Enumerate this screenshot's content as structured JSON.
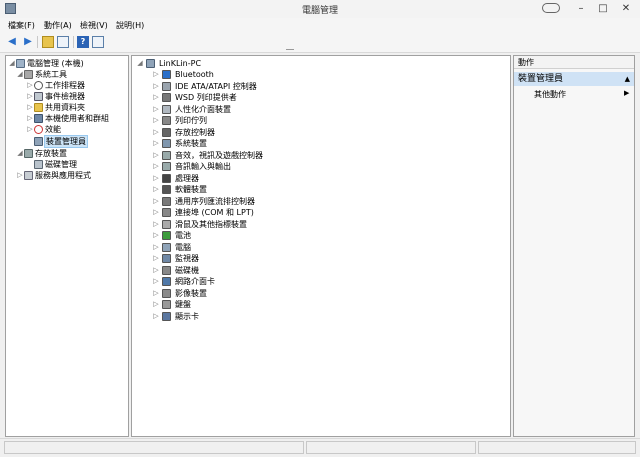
{
  "window": {
    "title": "電腦管理",
    "restore_label": "",
    "minimize_label": "–",
    "maximize_label": "□",
    "close_label": "✕"
  },
  "menu": [
    "檔案(F)",
    "動作(A)",
    "檢視(V)",
    "說明(H)"
  ],
  "toolbar": {
    "icons": [
      "back-arrow-icon",
      "forward-arrow-icon",
      "folder-up-icon",
      "show-hide-tree-icon",
      "help-icon",
      "console-icon"
    ]
  },
  "left_tree": [
    {
      "label": "電腦管理 (本機)",
      "icon": "computer-management-icon",
      "expander": "◢"
    },
    {
      "label": "系統工具",
      "icon": "system-tools-icon",
      "expander": "◢"
    },
    {
      "label": "工作排程器",
      "icon": "clock-icon",
      "expander": "▷"
    },
    {
      "label": "事件檢視器",
      "icon": "event-viewer-icon",
      "expander": "▷"
    },
    {
      "label": "共用資料夾",
      "icon": "shared-folder-icon",
      "expander": "▷"
    },
    {
      "label": "本機使用者和群組",
      "icon": "users-icon",
      "expander": "▷"
    },
    {
      "label": "效能",
      "icon": "performance-icon",
      "expander": "▷"
    },
    {
      "label": "裝置管理員",
      "icon": "device-manager-icon",
      "expander": ""
    },
    {
      "label": "存放裝置",
      "icon": "storage-icon",
      "expander": "◢"
    },
    {
      "label": "磁碟管理",
      "icon": "disk-management-icon",
      "expander": ""
    },
    {
      "label": "服務與應用程式",
      "icon": "services-icon",
      "expander": "▷"
    }
  ],
  "device_tree": {
    "root": {
      "label": "LinKLin-PC",
      "icon": "computer-icon",
      "expander": "◢"
    },
    "items": [
      {
        "label": "Bluetooth",
        "icon": "bluetooth-icon"
      },
      {
        "label": "IDE ATA/ATAPI 控制器",
        "icon": "ide-controller-icon"
      },
      {
        "label": "WSD 列印提供者",
        "icon": "printer-icon"
      },
      {
        "label": "人性化介面裝置",
        "icon": "hid-icon"
      },
      {
        "label": "列印佇列",
        "icon": "print-queue-icon"
      },
      {
        "label": "存放控制器",
        "icon": "storage-controller-icon"
      },
      {
        "label": "系統裝置",
        "icon": "system-device-icon"
      },
      {
        "label": "音效，視訊及遊戲控制器",
        "icon": "sound-icon"
      },
      {
        "label": "音訊輸入與輸出",
        "icon": "audio-io-icon"
      },
      {
        "label": "處理器",
        "icon": "processor-icon"
      },
      {
        "label": "軟體裝置",
        "icon": "software-device-icon"
      },
      {
        "label": "通用序列匯流排控制器",
        "icon": "usb-icon"
      },
      {
        "label": "連接埠 (COM 和 LPT)",
        "icon": "port-icon"
      },
      {
        "label": "滑鼠及其他指標裝置",
        "icon": "mouse-icon"
      },
      {
        "label": "電池",
        "icon": "battery-icon"
      },
      {
        "label": "電腦",
        "icon": "computer-icon"
      },
      {
        "label": "監視器",
        "icon": "monitor-icon"
      },
      {
        "label": "磁碟機",
        "icon": "disk-drive-icon"
      },
      {
        "label": "網路介面卡",
        "icon": "network-adapter-icon"
      },
      {
        "label": "影像裝置",
        "icon": "imaging-device-icon"
      },
      {
        "label": "鍵盤",
        "icon": "keyboard-icon"
      },
      {
        "label": "顯示卡",
        "icon": "display-adapter-icon"
      }
    ]
  },
  "actions_pane": {
    "header": "動作",
    "section": "裝置管理員",
    "section_caret": "▲",
    "sub_item": "其他動作",
    "sub_arrow": "▶"
  },
  "colors": {
    "selection": "#cce4f7",
    "section_bg": "#cfe2f5",
    "accent_blue": "#2a6fc9"
  }
}
